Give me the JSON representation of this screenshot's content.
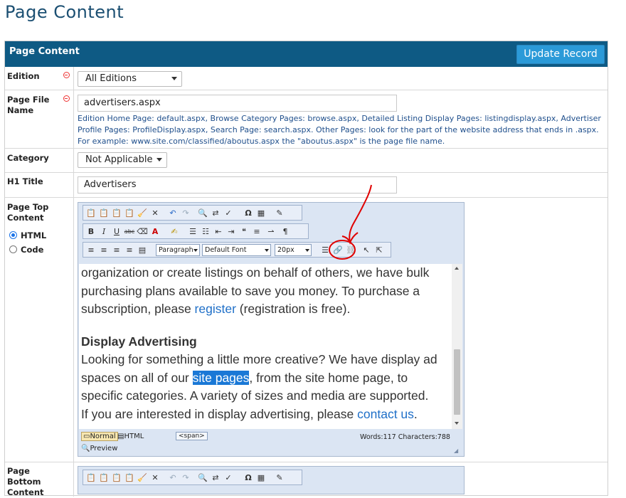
{
  "page": {
    "title": "Page Content"
  },
  "form": {
    "header_title": "Page Content",
    "update_button": "Update Record",
    "edition": {
      "label": "Edition",
      "value": "All Editions"
    },
    "page_file": {
      "label": "Page File Name",
      "value": "advertisers.aspx",
      "help": "Edition Home Page: default.aspx, Browse Category Pages: browse.aspx, Detailed Listing Display Pages: listingdisplay.aspx, Advertiser Profile Pages: ProfileDisplay.aspx, Search Page: search.aspx. Other Pages: look for the part of the website address that ends in .aspx. For example: www.site.com/classified/aboutus.aspx the \"aboutus.aspx\" is the page file name."
    },
    "category": {
      "label": "Category",
      "value": "Not Applicable"
    },
    "h1_title": {
      "label": "H1 Title",
      "value": "Advertisers"
    },
    "page_top": {
      "label": "Page Top Content",
      "mode_options": [
        "HTML",
        "Code"
      ],
      "selected_mode": "HTML"
    },
    "page_bottom": {
      "label": "Page Bottom Content"
    }
  },
  "editor": {
    "toolbar": {
      "paragraph": "Paragraph",
      "font": "Default Font",
      "size": "20px"
    },
    "content": {
      "p1_line1": "organization or create listings on behalf of others, we have bulk",
      "p1_line2": "purchasing plans available to save you money. To purchase a",
      "p1_line3a": "subscription, please ",
      "p1_link": "register",
      "p1_line3b": " (registration is free).",
      "heading": "Display Advertising",
      "p2_line1": "Looking for something a little more creative? We have display ad",
      "p2_line2a": "spaces on all of our ",
      "p2_selected_link": "site pages",
      "p2_line2b": ", from the site home page, to",
      "p2_line3": "specific categories. A variety of sizes and media are supported.",
      "p2_line4a": "If you are interested in display advertising, please ",
      "p2_link": "contact us",
      "p2_line4b": "."
    },
    "status": {
      "mode_normal": "Normal",
      "mode_html": "HTML",
      "mode_preview": "Preview",
      "tag": "<span>",
      "counts": "Words:117 Characters:788"
    }
  },
  "colors": {
    "header_bg": "#0e5a84",
    "button_bg": "#2b9ad8",
    "link": "#1e6fc8",
    "selection": "#1a78d6",
    "annotation": "#e00000"
  }
}
